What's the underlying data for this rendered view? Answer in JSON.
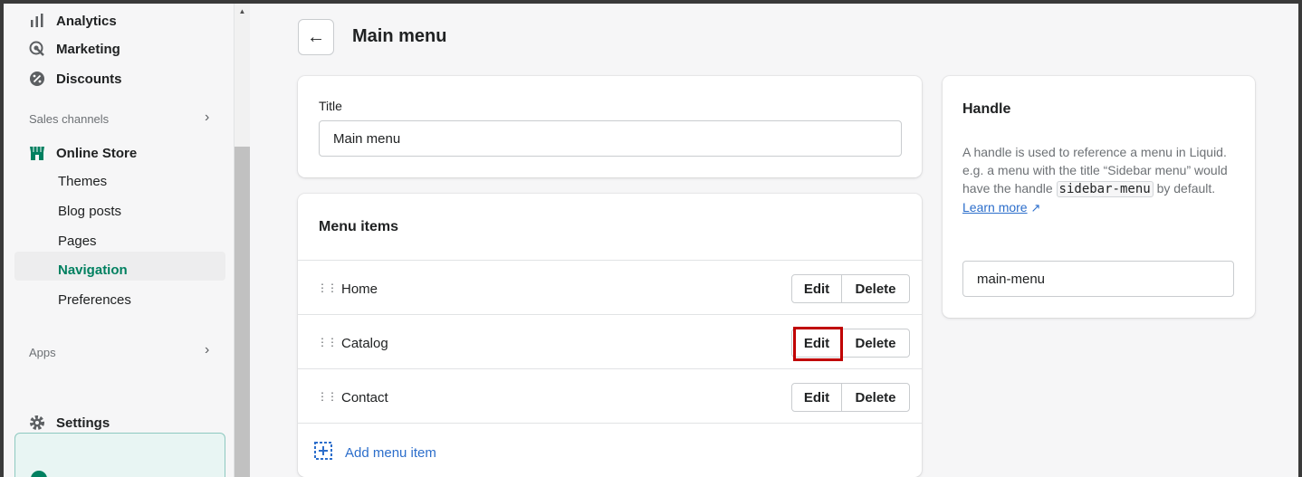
{
  "sidebar": {
    "analytics": "Analytics",
    "marketing": "Marketing",
    "discounts": "Discounts",
    "sales_channels_label": "Sales channels",
    "online_store": "Online Store",
    "sub_items": [
      "Themes",
      "Blog posts",
      "Pages",
      "Navigation",
      "Preferences"
    ],
    "active_sub_item": "Navigation",
    "apps_label": "Apps",
    "settings": "Settings"
  },
  "header": {
    "back_icon": "arrow-left-icon",
    "title": "Main menu"
  },
  "title_card": {
    "label": "Title",
    "value": "Main menu"
  },
  "menu_items_card": {
    "heading": "Menu items",
    "items": [
      {
        "label": "Home",
        "edit": "Edit",
        "delete": "Delete"
      },
      {
        "label": "Catalog",
        "edit": "Edit",
        "delete": "Delete"
      },
      {
        "label": "Contact",
        "edit": "Edit",
        "delete": "Delete"
      }
    ],
    "add_label": "Add menu item"
  },
  "handle_card": {
    "title": "Handle",
    "desc_1": "A handle is used to reference a menu in Liquid. e.g. a menu with the title “Sidebar menu” would have the handle ",
    "code": "sidebar-menu",
    "desc_2": " by default. ",
    "learn_more": "Learn more",
    "value": "main-menu"
  },
  "colors": {
    "accent_green": "#008060",
    "link_blue": "#2c6ecb",
    "highlight_red": "#c00000"
  }
}
